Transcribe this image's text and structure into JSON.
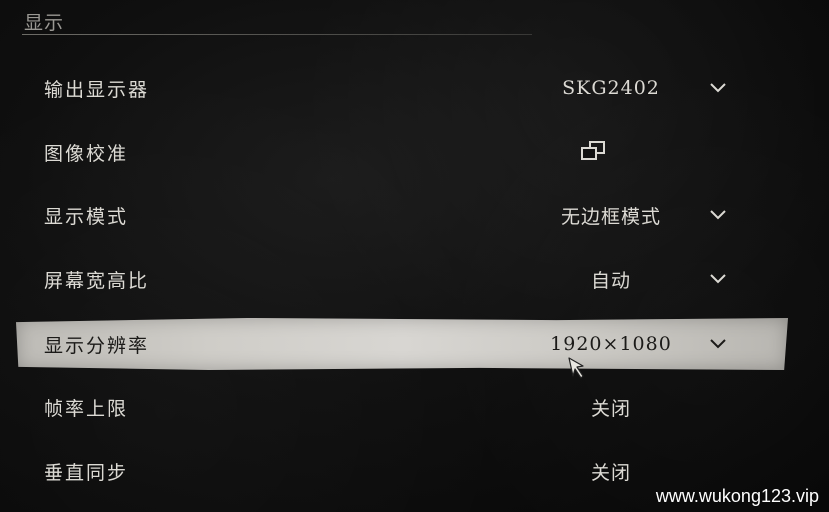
{
  "section": {
    "title": "显示"
  },
  "settings": [
    {
      "label": "输出显示器",
      "value": "SKG2402",
      "control": "dropdown"
    },
    {
      "label": "图像校准",
      "value": "",
      "control": "windows-icon"
    },
    {
      "label": "显示模式",
      "value": "无边框模式",
      "control": "dropdown"
    },
    {
      "label": "屏幕宽高比",
      "value": "自动",
      "control": "dropdown"
    },
    {
      "label": "显示分辨率",
      "value": "1920×1080",
      "control": "dropdown",
      "selected": true
    },
    {
      "label": "帧率上限",
      "value": "关闭",
      "control": "none"
    },
    {
      "label": "垂直同步",
      "value": "关闭",
      "control": "none"
    }
  ],
  "watermark": "www.wukong123.vip",
  "colors": {
    "background": "#0e0e0e",
    "text": "#dcdad4",
    "selected_bg": "#cfcdc8",
    "selected_text": "#1b1a18"
  }
}
